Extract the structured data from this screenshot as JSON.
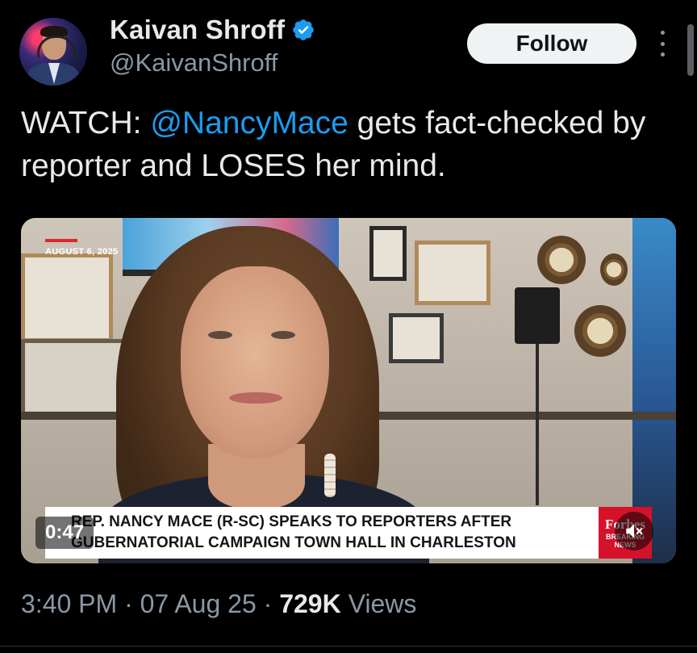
{
  "author": {
    "display_name": "Kaivan Shroff",
    "handle": "@KaivanShroff",
    "verified": true,
    "verified_color": "#1d9bf0"
  },
  "follow_button": {
    "label": "Follow"
  },
  "tweet": {
    "text_prefix": "WATCH: ",
    "mention": "@NancyMace",
    "text_suffix": " gets fact-checked by reporter and LOSES her mind."
  },
  "video": {
    "date_tag": "AUGUST 6, 2025",
    "lower_third_line1": "REP. NANCY MACE (R-SC) SPEAKS TO REPORTERS AFTER",
    "lower_third_line2": "GUBERNATORIAL CAMPAIGN TOWN HALL IN CHARLESTON",
    "brand": "Forbes",
    "brand_sub1": "BREAKING",
    "brand_sub2": "NEWS",
    "duration": "0:47",
    "muted": true
  },
  "meta": {
    "time": "3:40 PM",
    "separator": " · ",
    "date": "07 Aug 25",
    "views_count": "729K",
    "views_label": " Views"
  },
  "colors": {
    "background": "#000000",
    "text": "#e7e9ea",
    "secondary_text": "#8b98a5",
    "link": "#1d9bf0",
    "accent_red": "#d5122a"
  }
}
